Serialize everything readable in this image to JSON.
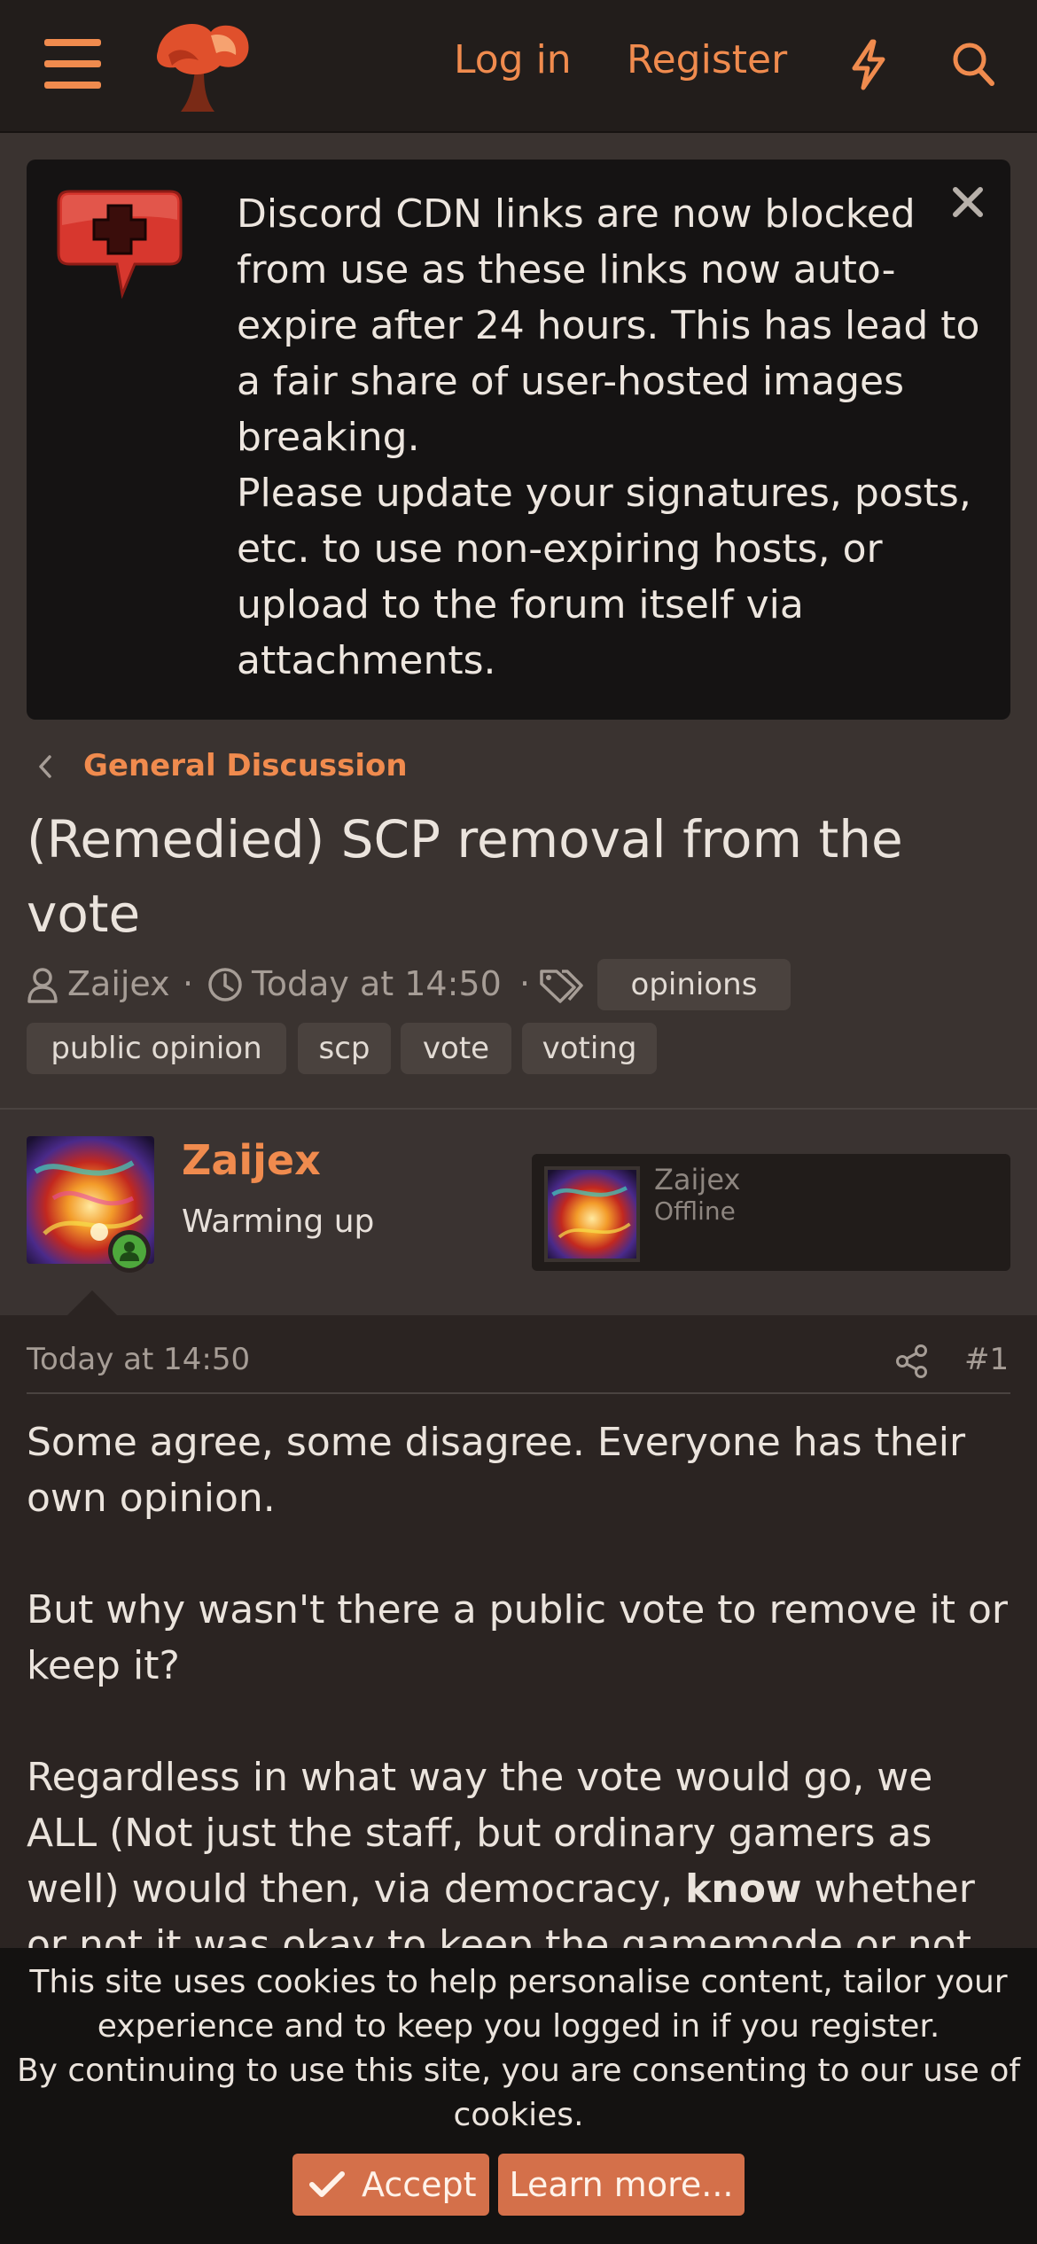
{
  "header": {
    "login_label": "Log in",
    "register_label": "Register",
    "icons": [
      "menu-icon",
      "logo",
      "bolt-icon",
      "search-icon"
    ]
  },
  "notice": {
    "paragraphs": [
      "Discord CDN links are now blocked from use as these links now auto-expire after 24 hours. This has lead to a fair share of user-hosted images breaking.",
      "Please update your signatures, posts, etc. to use non-expiring hosts, or upload to the forum itself via attachments."
    ]
  },
  "breadcrumb": {
    "label": "General Discussion"
  },
  "thread": {
    "title": "(Remedied) SCP removal from the vote",
    "author": "Zaijex",
    "date": "Today at 14:50",
    "tags": [
      "opinions",
      "public opinion",
      "scp",
      "vote",
      "voting"
    ]
  },
  "post_author": {
    "name": "Zaijex",
    "user_title": "Warming up",
    "card_name": "Zaijex",
    "card_status": "Offline"
  },
  "post": {
    "date": "Today at 14:50",
    "number": "#1",
    "p1": "Some agree, some disagree. Everyone has their own opinion.",
    "p2": "But why wasn't there a public vote to remove it or keep it?",
    "p3_before": "Regardless in what way the vote would go, we ALL (Not just the staff, but ordinary gamers as well) would then, via democracy, ",
    "p3_bold": "know",
    "p3_after": " whether or not it was okay to keep the gamemode or not."
  },
  "cookie": {
    "line1": "This site uses cookies to help personalise content, tailor your experience and to keep you logged in if you register.",
    "line2": "By continuing to use this site, you are consenting to our use of cookies.",
    "accept_label": "Accept",
    "learn_label": "Learn more..."
  },
  "colors": {
    "accent": "#f08b4e",
    "background": "#3a3330",
    "header": "#221d1b",
    "notice": "#151313",
    "button": "#d4704a",
    "online": "#4ea83c"
  }
}
